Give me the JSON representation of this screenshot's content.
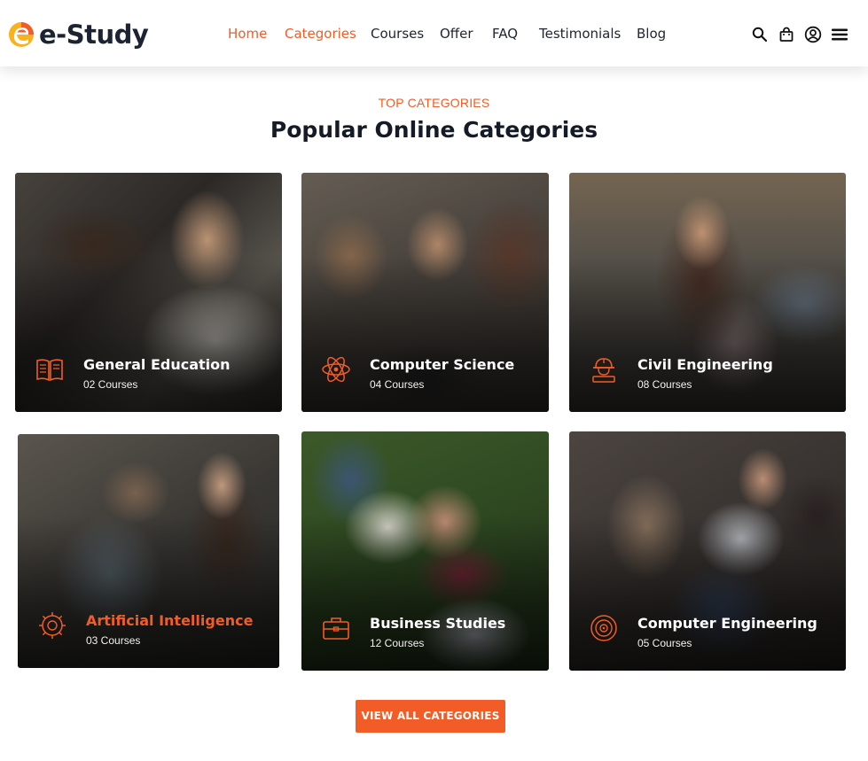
{
  "brand": {
    "name": "e-Study",
    "accent_color": "#f25c26",
    "dark_color": "#1c2434"
  },
  "nav": {
    "items": [
      {
        "label": "Home",
        "active": true
      },
      {
        "label": "Categories",
        "active": true
      },
      {
        "label": "Courses",
        "active": false
      },
      {
        "label": "Offer",
        "active": false
      },
      {
        "label": "FAQ",
        "active": false
      },
      {
        "label": "Testimonials",
        "active": false
      },
      {
        "label": "Blog",
        "active": false
      }
    ]
  },
  "header_icons": [
    "search-icon",
    "shopping-bag-icon",
    "user-account-icon",
    "menu-hamburger-icon"
  ],
  "section": {
    "eyebrow": "TOP CATEGORIES",
    "title": "Popular Online Categories"
  },
  "categories": [
    {
      "name": "General Education",
      "count": "02 Courses",
      "icon": "book-icon",
      "highlighted": false
    },
    {
      "name": "Computer Science",
      "count": "04 Courses",
      "icon": "atom-icon",
      "highlighted": false
    },
    {
      "name": "Civil Engineering",
      "count": "08 Courses",
      "icon": "engineer-helmet-icon",
      "highlighted": false
    },
    {
      "name": "Artificial Intelligence",
      "count": "03 Courses",
      "icon": "ai-brain-icon",
      "highlighted": true
    },
    {
      "name": "Business Studies",
      "count": "12 Courses",
      "icon": "briefcase-icon",
      "highlighted": false
    },
    {
      "name": "Computer Engineering",
      "count": "05 Courses",
      "icon": "target-chip-icon",
      "highlighted": false
    }
  ],
  "cta": {
    "label": "VIEW ALL CATEGORIES"
  }
}
